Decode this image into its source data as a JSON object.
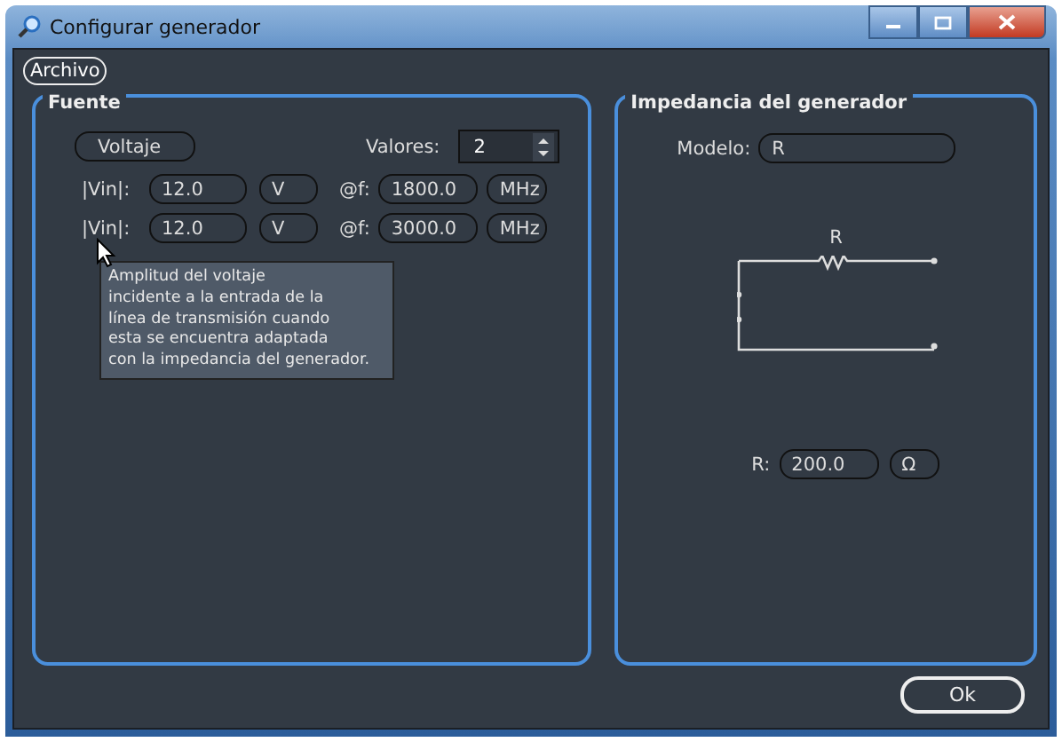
{
  "window": {
    "title": "Configurar generador"
  },
  "menu": [
    {
      "label": "Archivo"
    }
  ],
  "fuente": {
    "title": "Fuente",
    "mode": "Voltaje",
    "count_label": "Valores:",
    "count": "2",
    "rows": [
      {
        "label": "|Vin|:",
        "value": "12.0",
        "unit": "V",
        "freq_label": "@f:",
        "freq": "1800.0",
        "freq_unit": "MHz"
      },
      {
        "label": "|Vin|:",
        "value": "12.0",
        "unit": "V",
        "freq_label": "@f:",
        "freq": "3000.0",
        "freq_unit": "MHz"
      }
    ],
    "tooltip": "Amplitud del voltaje\nincidente a la entrada de la\nlínea de transmisión cuando\nesta se encuentra adaptada\ncon la impedancia del generador."
  },
  "impedancia": {
    "title": "Impedancia del generador",
    "model_label": "Modelo:",
    "model": "R",
    "circuit_label": "R",
    "r_label": "R:",
    "r_value": "200.0",
    "r_unit": "Ω"
  },
  "ok": "Ok"
}
